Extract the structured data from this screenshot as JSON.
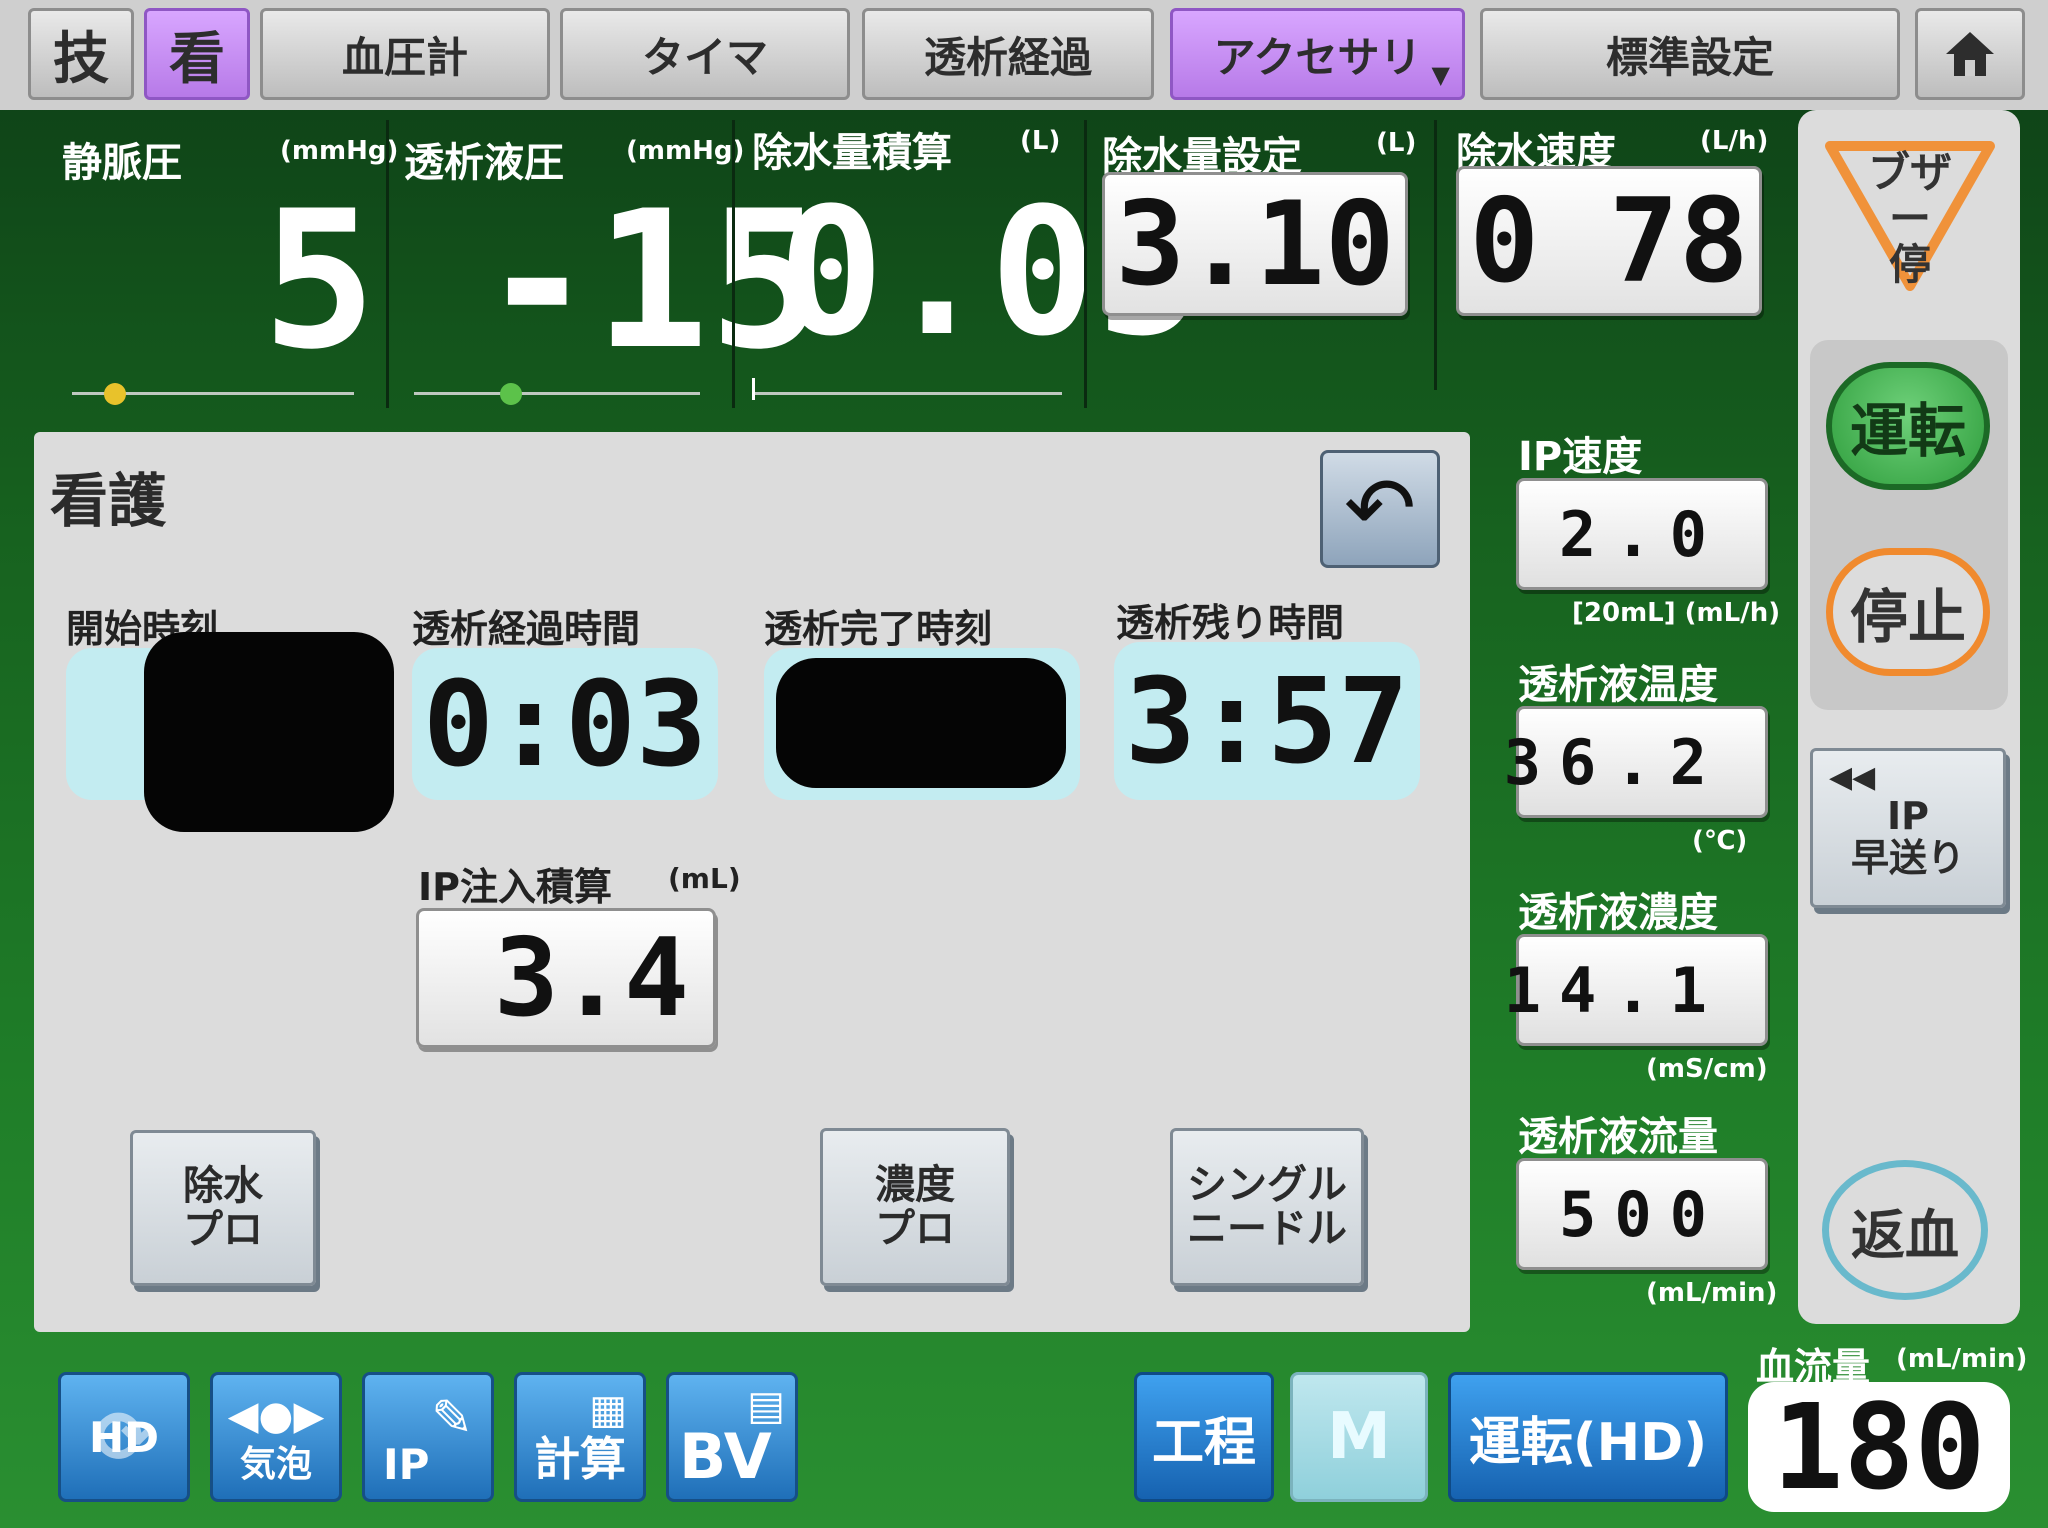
{
  "tabs": {
    "gi": "技",
    "kan": "看",
    "ketsuatsu": "血圧計",
    "timer": "タイマ",
    "keika": "透析経過",
    "accessory": "アクセサリ",
    "hyojun": "標準設定",
    "home_icon": "home-icon"
  },
  "monitors": {
    "venous": {
      "label": "静脈圧",
      "unit": "(mmHg)",
      "value": "5"
    },
    "dialysate_pressure": {
      "label": "透析液圧",
      "unit": "(mmHg)",
      "value": "-15"
    },
    "uf_total": {
      "label": "除水量積算",
      "unit": "(L)",
      "value": "0.05"
    },
    "uf_goal": {
      "label": "除水量設定",
      "unit": "(L)",
      "value": "3.10"
    },
    "uf_rate": {
      "label": "除水速度",
      "unit": "(L/h)",
      "value": "0 78"
    }
  },
  "panel": {
    "title": "看護",
    "start_time_label": "開始時刻",
    "elapsed_label": "透析経過時間",
    "elapsed_value": "0:03",
    "end_time_label": "透析完了時刻",
    "remaining_label": "透析残り時間",
    "remaining_value": "3:57",
    "ip_total_label": "IP注入積算",
    "ip_total_unit": "(mL)",
    "ip_total_value": "3.4",
    "btn_uf_profile": "除水\nプロ",
    "btn_conc_profile": "濃度\nプロ",
    "btn_single_needle": "シングル\nニードル"
  },
  "right": {
    "ip_rate": {
      "label": "IP速度",
      "value": "2.0",
      "unit": "[20mL] (mL/h)"
    },
    "temp": {
      "label": "透析液温度",
      "value": "36.2",
      "unit": "(℃)"
    },
    "conc": {
      "label": "透析液濃度",
      "value": "14.1",
      "unit": "(mS/cm)"
    },
    "flow": {
      "label": "透析液流量",
      "value": "500",
      "unit": "(mL/min)"
    }
  },
  "side": {
    "buzzer": "ブザー\n停",
    "run": "運転",
    "stop": "停止",
    "ip_ff": "IP\n早送り",
    "return": "返血"
  },
  "bottom": {
    "hd": "HD",
    "bubble": "気泡",
    "ip": "IP",
    "calc": "計算",
    "bv": "BV",
    "process": "工程",
    "m": "M",
    "run_hd": "運転(HD)",
    "blood_flow_label": "血流量",
    "blood_flow_unit": "(mL/min)",
    "blood_flow_value": "180"
  },
  "colors": {
    "accent_purple": "#b77ae8",
    "screen_green": "#1f7d28",
    "run_green": "#2e9d3c",
    "stop_orange": "#f08a2e",
    "button_blue": "#1f6fb8",
    "time_box_cyan": "#c3ecf1"
  }
}
